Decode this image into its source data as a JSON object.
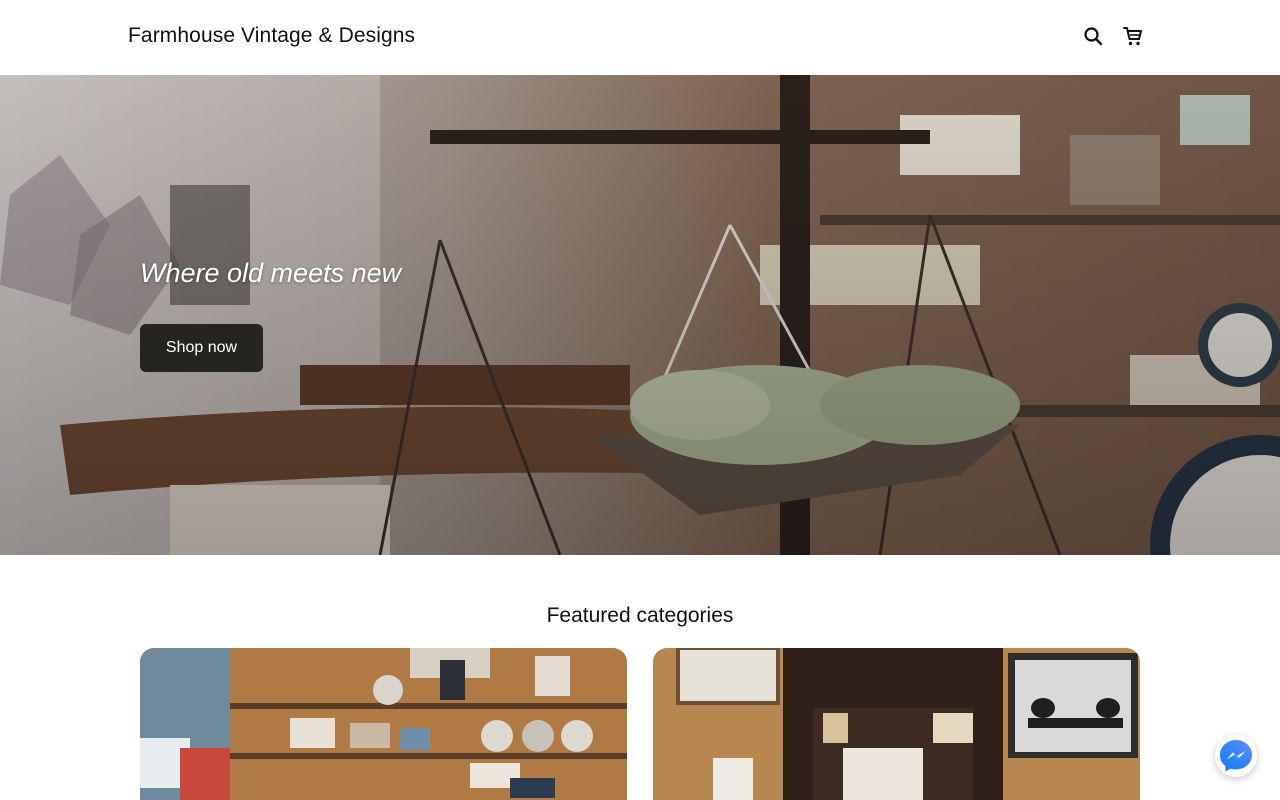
{
  "header": {
    "brand": "Farmhouse Vintage & Designs",
    "icons": [
      "search-icon",
      "cart-icon"
    ]
  },
  "hero": {
    "tagline": "Where old meets new",
    "cta_label": "Shop now"
  },
  "featured": {
    "title": "Featured categories",
    "cards": [
      {
        "image": "shop-shelves-photo"
      },
      {
        "image": "welcome-sign-hutch-photo"
      }
    ]
  },
  "chat": {
    "icon": "messenger-icon"
  },
  "colors": {
    "button_bg": "#262421",
    "text": "#111111",
    "background": "#ffffff"
  }
}
